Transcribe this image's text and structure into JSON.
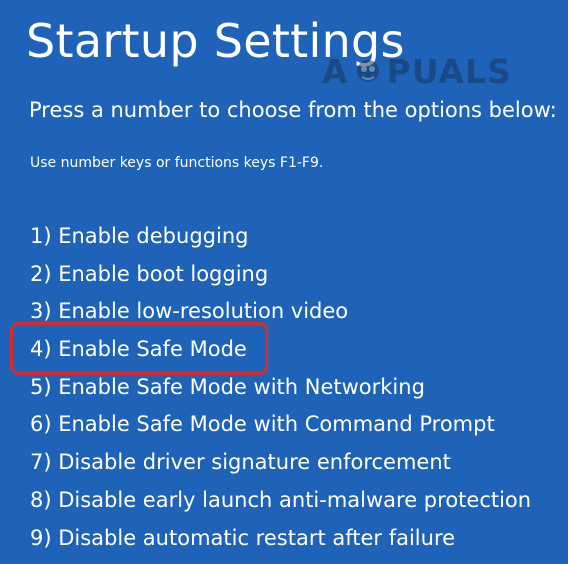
{
  "screen": {
    "title": "Startup Settings",
    "prompt": "Press a number to choose from the options below:",
    "hint": "Use number keys or functions keys F1-F9."
  },
  "watermark": {
    "text_left": "A",
    "text_right": "PUALS"
  },
  "options": [
    {
      "label": "1) Enable debugging"
    },
    {
      "label": "2) Enable boot logging"
    },
    {
      "label": "3) Enable low-resolution video"
    },
    {
      "label": "4) Enable Safe Mode"
    },
    {
      "label": "5) Enable Safe Mode with Networking"
    },
    {
      "label": "6) Enable Safe Mode with Command Prompt"
    },
    {
      "label": "7) Disable driver signature enforcement"
    },
    {
      "label": "8) Disable early launch anti-malware protection"
    },
    {
      "label": "9) Disable automatic restart after failure"
    }
  ],
  "highlight": {
    "color": "#d92b2b",
    "target": "4) Enable Safe Mode"
  },
  "colors": {
    "background": "#1f63b8",
    "text": "#ffffff"
  }
}
